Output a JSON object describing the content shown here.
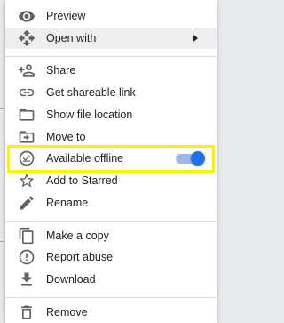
{
  "menu": {
    "group1": [
      {
        "label": "Preview",
        "icon": "eye-icon"
      },
      {
        "label": "Open with",
        "icon": "move-arrows-icon",
        "has_submenu": true
      }
    ],
    "group2": [
      {
        "label": "Share",
        "icon": "add-person-icon"
      },
      {
        "label": "Get shareable link",
        "icon": "link-icon"
      },
      {
        "label": "Show file location",
        "icon": "folder-icon"
      },
      {
        "label": "Move to",
        "icon": "move-to-folder-icon"
      },
      {
        "label": "Available offline",
        "icon": "offline-check-icon",
        "toggle_on": true
      },
      {
        "label": "Add to Starred",
        "icon": "star-icon"
      },
      {
        "label": "Rename",
        "icon": "pencil-icon"
      }
    ],
    "group3": [
      {
        "label": "Make a copy",
        "icon": "copy-icon"
      },
      {
        "label": "Report abuse",
        "icon": "report-icon"
      },
      {
        "label": "Download",
        "icon": "download-icon"
      }
    ],
    "group4": [
      {
        "label": "Remove",
        "icon": "trash-icon"
      }
    ]
  },
  "colors": {
    "highlight": "#fff200",
    "toggle_on": "#1a73e8",
    "icon": "#5f6368"
  }
}
